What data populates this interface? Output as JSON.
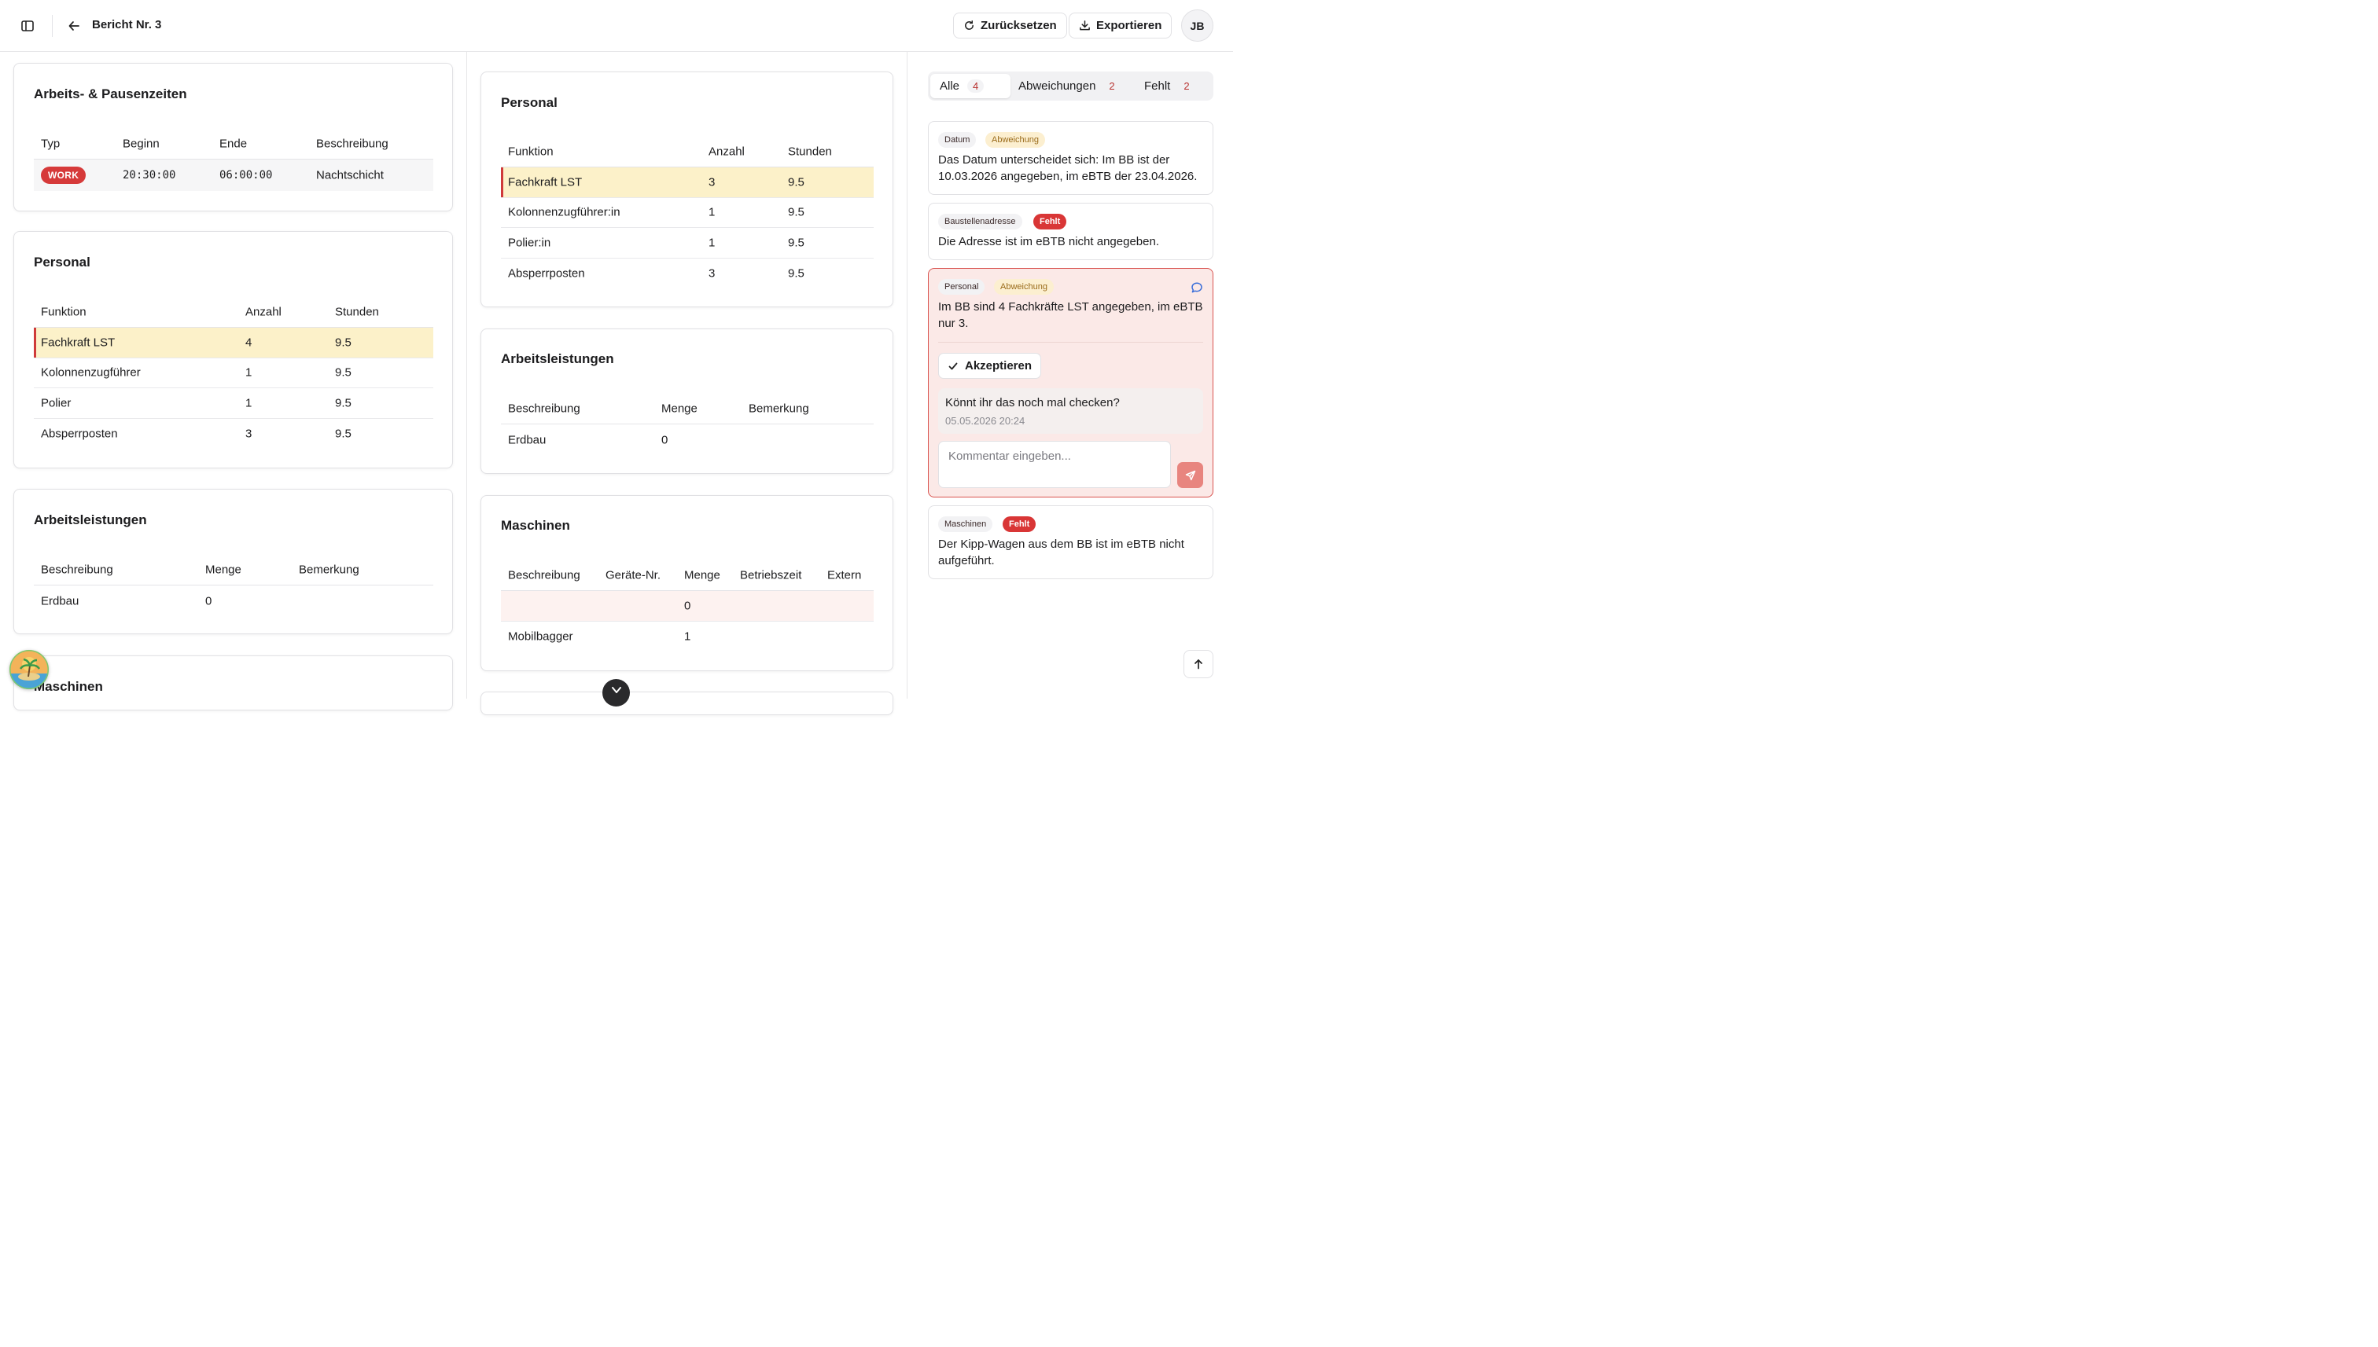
{
  "header": {
    "title": "Bericht Nr. 3",
    "reset_label": "Zurücksetzen",
    "export_label": "Exportieren",
    "avatar_initials": "JB"
  },
  "left": {
    "times": {
      "title": "Arbeits- & Pausenzeiten",
      "headers": [
        "Typ",
        "Beginn",
        "Ende",
        "Beschreibung"
      ],
      "row": {
        "type": "WORK",
        "start": "20:30:00",
        "end": "06:00:00",
        "desc": "Nachtschicht"
      }
    },
    "personnel": {
      "title": "Personal",
      "headers": [
        "Funktion",
        "Anzahl",
        "Stunden"
      ],
      "rows": [
        {
          "function": "Fachkraft LST",
          "count": "4",
          "hours": "9.5"
        },
        {
          "function": "Kolonnenzugführer",
          "count": "1",
          "hours": "9.5"
        },
        {
          "function": "Polier",
          "count": "1",
          "hours": "9.5"
        },
        {
          "function": "Absperrposten",
          "count": "3",
          "hours": "9.5"
        }
      ]
    },
    "work": {
      "title": "Arbeitsleistungen",
      "headers": [
        "Beschreibung",
        "Menge",
        "Bemerkung"
      ],
      "rows": [
        {
          "desc": "Erdbau",
          "qty": "0",
          "note": ""
        }
      ]
    },
    "machines_title": "Maschinen"
  },
  "middle": {
    "personnel": {
      "title": "Personal",
      "headers": [
        "Funktion",
        "Anzahl",
        "Stunden"
      ],
      "rows": [
        {
          "function": "Fachkraft LST",
          "count": "3",
          "hours": "9.5"
        },
        {
          "function": "Kolonnenzugführer:in",
          "count": "1",
          "hours": "9.5"
        },
        {
          "function": "Polier:in",
          "count": "1",
          "hours": "9.5"
        },
        {
          "function": "Absperrposten",
          "count": "3",
          "hours": "9.5"
        }
      ]
    },
    "work": {
      "title": "Arbeitsleistungen",
      "headers": [
        "Beschreibung",
        "Menge",
        "Bemerkung"
      ],
      "rows": [
        {
          "desc": "Erdbau",
          "qty": "0",
          "note": ""
        }
      ]
    },
    "machines": {
      "title": "Maschinen",
      "headers": [
        "Beschreibung",
        "Geräte-Nr.",
        "Menge",
        "Betriebszeit",
        "Extern"
      ],
      "rows": [
        {
          "desc": "",
          "device": "",
          "qty": "0",
          "runtime": "",
          "external": ""
        },
        {
          "desc": "Mobilbagger",
          "device": "",
          "qty": "1",
          "runtime": "",
          "external": ""
        }
      ]
    }
  },
  "right": {
    "tabs": [
      {
        "label": "Alle",
        "count": "4"
      },
      {
        "label": "Abweichungen",
        "count": "2"
      },
      {
        "label": "Fehlt",
        "count": "2"
      }
    ],
    "issues": [
      {
        "category": "Datum",
        "status": "Abweichung",
        "text": "Das Datum unterscheidet sich: Im BB ist der 10.03.2026 angegeben, im eBTB der 23.04.2026."
      },
      {
        "category": "Baustellenadresse",
        "status": "Fehlt",
        "text": "Die Adresse ist im eBTB nicht angegeben."
      },
      {
        "category": "Personal",
        "status": "Abweichung",
        "text": "Im BB sind 4 Fachkräfte LST angegeben, im eBTB nur 3.",
        "accept_label": "Akzeptieren",
        "comment": {
          "text": "Könnt ihr das noch mal checken?",
          "timestamp": "05.05.2026 20:24"
        },
        "comment_placeholder": "Kommentar eingeben..."
      },
      {
        "category": "Maschinen",
        "status": "Fehlt",
        "text": "Der Kipp-Wagen aus dem BB ist im eBTB nicht aufgeführt."
      }
    ]
  },
  "colors": {
    "accent_red": "#d63a3a",
    "highlight_yellow": "#fcf1c9",
    "selected_issue_bg": "#fbe9e7"
  }
}
